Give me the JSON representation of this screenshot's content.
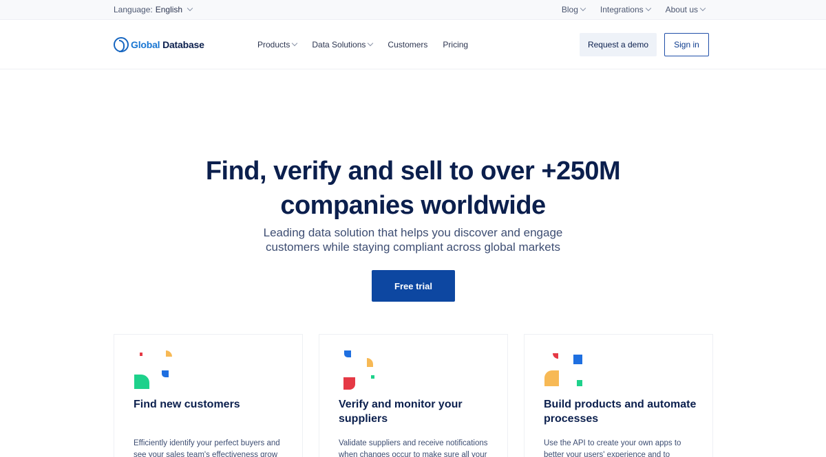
{
  "topbar": {
    "language_label": "Language:",
    "language_value": "English",
    "links": [
      "Blog",
      "Integrations",
      "About us"
    ]
  },
  "nav": {
    "logo_global": "Global",
    "logo_database": "Database",
    "menu": [
      "Products",
      "Data Solutions",
      "Customers",
      "Pricing"
    ],
    "demo_label": "Request a demo",
    "signin_label": "Sign in"
  },
  "hero": {
    "title_line1": "Find, verify and sell to over +250M",
    "title_line2": "companies worldwide",
    "subtitle_line1": "Leading data solution that helps you discover and engage",
    "subtitle_line2": "customers while staying compliant across global markets",
    "cta_label": "Free trial"
  },
  "cards": [
    {
      "title": "Find new customers",
      "body": "Efficiently identify your perfect buyers and see your sales team's effectiveness grow"
    },
    {
      "title": "Verify and monitor your suppliers",
      "body": "Validate suppliers and receive notifications when changes occur to make sure all your"
    },
    {
      "title": "Build products and automate processes",
      "body": "Use the API to create your own apps to better your users' experience and to"
    }
  ],
  "colors": {
    "brand_blue": "#0d47a1",
    "navy_text": "#0b1f4d",
    "accent_red": "#e53945",
    "accent_orange": "#f7b955",
    "accent_blue": "#1e6fe0",
    "accent_green": "#1ed18b"
  }
}
